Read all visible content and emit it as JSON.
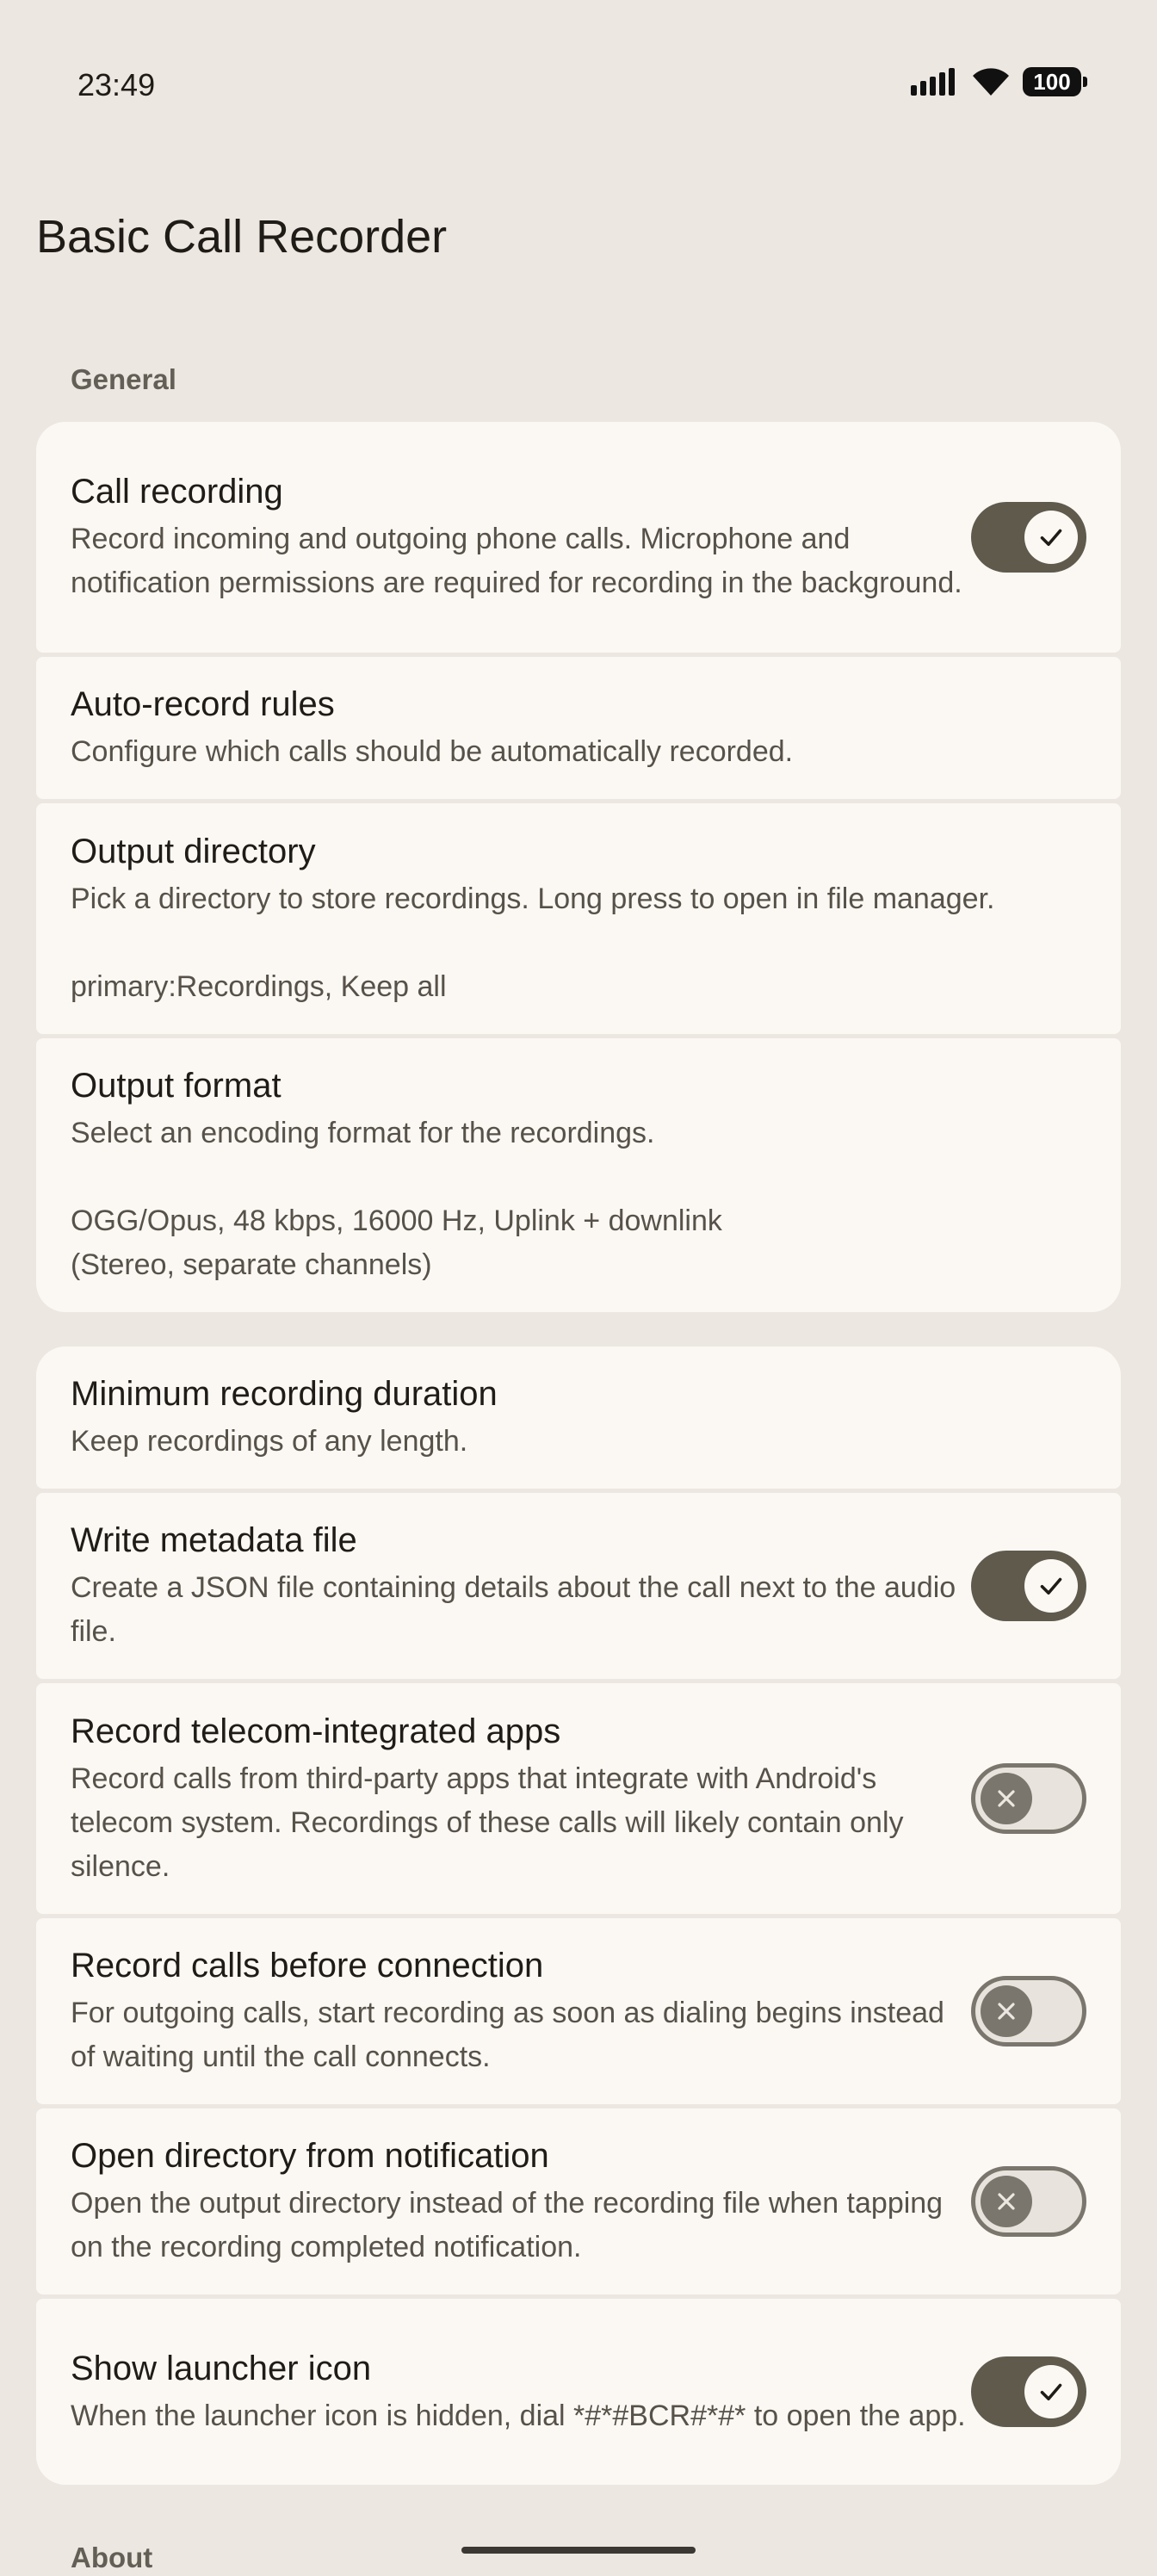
{
  "status_bar": {
    "time": "23:49",
    "battery": "100"
  },
  "app_title": "Basic Call Recorder",
  "sections": {
    "general": "General",
    "about": "About"
  },
  "items": {
    "call_recording": {
      "title": "Call recording",
      "summary": "Record incoming and outgoing phone calls. Microphone and notification permissions are required for recording in the background.",
      "enabled": true
    },
    "auto_record_rules": {
      "title": "Auto-record rules",
      "summary": "Configure which calls should be automatically recorded."
    },
    "output_directory": {
      "title": "Output directory",
      "summary": "Pick a directory to store recordings. Long press to open in file manager.",
      "value": "primary:Recordings, Keep all"
    },
    "output_format": {
      "title": "Output format",
      "summary": "Select an encoding format for the recordings.",
      "value": "OGG/Opus, 48 kbps, 16000 Hz, Uplink + downlink (Stereo, separate channels)"
    },
    "min_duration": {
      "title": "Minimum recording duration",
      "summary": "Keep recordings of any length."
    },
    "write_metadata": {
      "title": "Write metadata file",
      "summary": "Create a JSON file containing details about the call next to the audio file.",
      "enabled": true
    },
    "telecom_apps": {
      "title": "Record telecom-integrated apps",
      "summary": "Record calls from third-party apps that integrate with Android's telecom system. Recordings of these calls will likely contain only silence.",
      "enabled": false
    },
    "before_connection": {
      "title": "Record calls before connection",
      "summary": "For outgoing calls, start recording as soon as dialing begins instead of waiting until the call connects.",
      "enabled": false
    },
    "open_directory": {
      "title": "Open directory from notification",
      "summary": "Open the output directory instead of the recording file when tapping on the recording completed notification.",
      "enabled": false
    },
    "launcher_icon": {
      "title": "Show launcher icon",
      "summary": "When the launcher icon is hidden, dial *#*#BCR#*#* to open the app.",
      "enabled": true
    }
  },
  "colors": {
    "background": "#ece7e1",
    "card": "#fbf8f4",
    "toggle_on": "#5f5a4c",
    "toggle_off_outline": "#7b766d"
  }
}
